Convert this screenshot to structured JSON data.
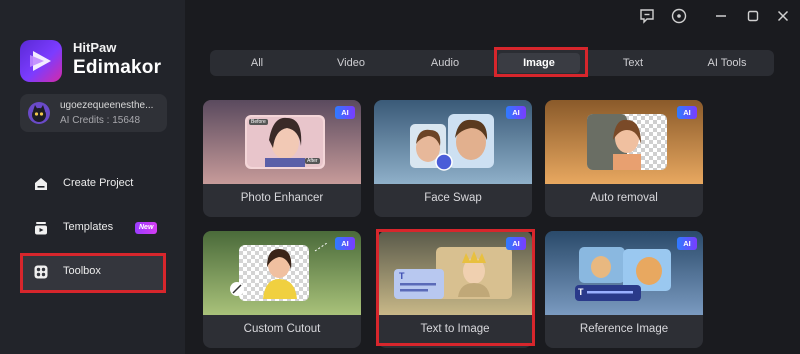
{
  "app": {
    "brand_top": "HitPaw",
    "brand_main": "Edimakor"
  },
  "account": {
    "username": "ugoezequeenesthe...",
    "credits": "AI Credits : 15648"
  },
  "sidebar": {
    "items": [
      {
        "label": "Create Project",
        "icon": "home-icon"
      },
      {
        "label": "Templates",
        "icon": "templates-icon",
        "badge": "New"
      },
      {
        "label": "Toolbox",
        "icon": "toolbox-icon"
      }
    ]
  },
  "tabs": [
    {
      "label": "All"
    },
    {
      "label": "Video"
    },
    {
      "label": "Audio"
    },
    {
      "label": "Image",
      "active": true
    },
    {
      "label": "Text"
    },
    {
      "label": "AI Tools"
    }
  ],
  "cards": [
    {
      "label": "Photo Enhancer",
      "badge": "AI",
      "thumb_tags": [
        "Before",
        "After"
      ]
    },
    {
      "label": "Face Swap",
      "badge": "AI"
    },
    {
      "label": "Auto removal",
      "badge": "AI"
    },
    {
      "label": "Custom Cutout",
      "badge": "AI"
    },
    {
      "label": "Text to Image",
      "badge": "AI",
      "thumb_glyph": "T"
    },
    {
      "label": "Reference Image",
      "badge": "AI",
      "thumb_glyph": "T"
    }
  ],
  "colors": {
    "highlight": "#d7262c",
    "accent_purple": "#7c3cff",
    "ai_badge_blue": "#2e7cff"
  }
}
